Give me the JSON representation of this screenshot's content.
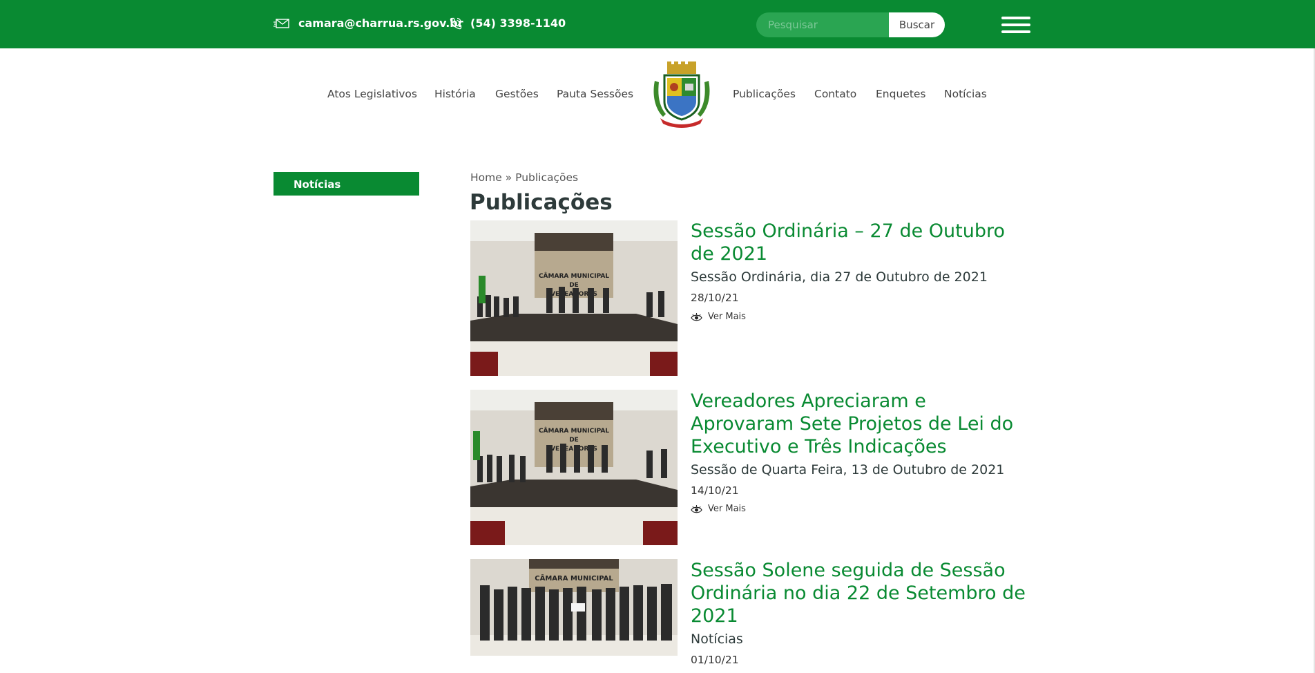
{
  "header": {
    "email": "camara@charrua.rs.gov.br",
    "phone": "(54) 3398-1140",
    "search_placeholder": "Pesquisar",
    "search_button": "Buscar"
  },
  "nav": {
    "left": [
      "Atos Legislativos",
      "História",
      "Gestões",
      "Pauta Sessões"
    ],
    "right": [
      "Publicações",
      "Contato",
      "Enquetes",
      "Notícias"
    ]
  },
  "sidebar": {
    "active_item": "Notícias"
  },
  "breadcrumb": {
    "home": "Home",
    "separator": "»",
    "current": "Publicações"
  },
  "page_title": "Publicações",
  "posts": [
    {
      "title": "Sessão Ordinária – 27 de Outubro de 2021",
      "subtitle": "Sessão Ordinária, dia 27 de Outubro de 2021",
      "date": "28/10/21",
      "more": "Ver Mais",
      "image_caption_lines": [
        "CÂMARA MUNICIPAL",
        "DE",
        "VEREADORES"
      ]
    },
    {
      "title": "Vereadores Apreciaram e Aprovaram Sete Projetos de Lei do Executivo e Três Indicações",
      "subtitle": "Sessão de Quarta Feira, 13 de Outubro de 2021",
      "date": "14/10/21",
      "more": "Ver Mais",
      "image_caption_lines": [
        "CÂMARA MUNICIPAL",
        "DE",
        "VEREADORES"
      ]
    },
    {
      "title": "Sessão Solene seguida de Sessão Ordinária no dia 22 de Setembro de 2021",
      "subtitle": "Notícias",
      "date": "01/10/21",
      "image_caption_lines": [
        "CÂMARA MUNICIPAL"
      ]
    }
  ],
  "colors": {
    "brand_green": "#098a32",
    "text_dark": "#2d3a3a"
  },
  "icons": [
    "envelope-icon",
    "phone-icon",
    "hamburger-menu-icon",
    "eye-icon",
    "municipal-crest-logo"
  ]
}
